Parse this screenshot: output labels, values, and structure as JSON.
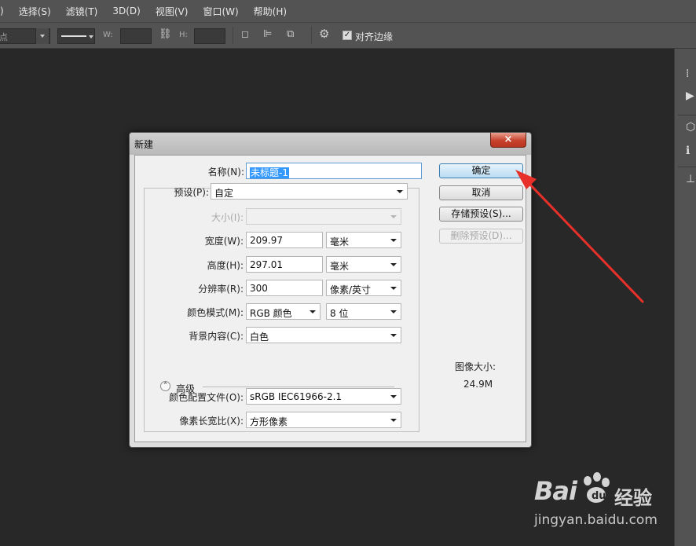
{
  "menu": [
    "选择(S)",
    "滤镜(T)",
    "3D(D)",
    "视图(V)",
    "窗口(W)",
    "帮助(H)"
  ],
  "menu_first_fragment": ")",
  "options_bar": {
    "mode_fragment": "点",
    "w_label": "W:",
    "h_label": "H:",
    "align_edges_label": "对齐边缘",
    "align_edges_checked": true
  },
  "dialog": {
    "title": "新建",
    "close_glyph": "×",
    "name_label": "名称(N):",
    "name_value": "未标题-1",
    "preset_label": "预设(P):",
    "preset_value": "自定",
    "size_label": "大小(I):",
    "size_value": "",
    "width_label": "宽度(W):",
    "width_value": "209.97",
    "width_unit": "毫米",
    "height_label": "高度(H):",
    "height_value": "297.01",
    "height_unit": "毫米",
    "resolution_label": "分辨率(R):",
    "resolution_value": "300",
    "resolution_unit": "像素/英寸",
    "color_mode_label": "颜色模式(M):",
    "color_mode_value": "RGB 颜色",
    "bit_depth_value": "8 位",
    "background_label": "背景内容(C):",
    "background_value": "白色",
    "advanced_label": "高级",
    "color_profile_label": "颜色配置文件(O):",
    "color_profile_value": "sRGB IEC61966-2.1",
    "pixel_aspect_label": "像素长宽比(X):",
    "pixel_aspect_value": "方形像素",
    "ok_button": "确定",
    "cancel_button": "取消",
    "save_preset_button": "存储预设(S)...",
    "delete_preset_button": "删除预设(D)...",
    "image_size_label": "图像大小:",
    "image_size_value": "24.9M"
  },
  "watermark": {
    "brand": "Bai",
    "brand_cn": "经验",
    "url": "jingyan.baidu.com"
  },
  "colors": {
    "canvas": "#282828",
    "chrome": "#535353",
    "arrow": "#e8302a",
    "primary_button": "#b9dcf3"
  }
}
